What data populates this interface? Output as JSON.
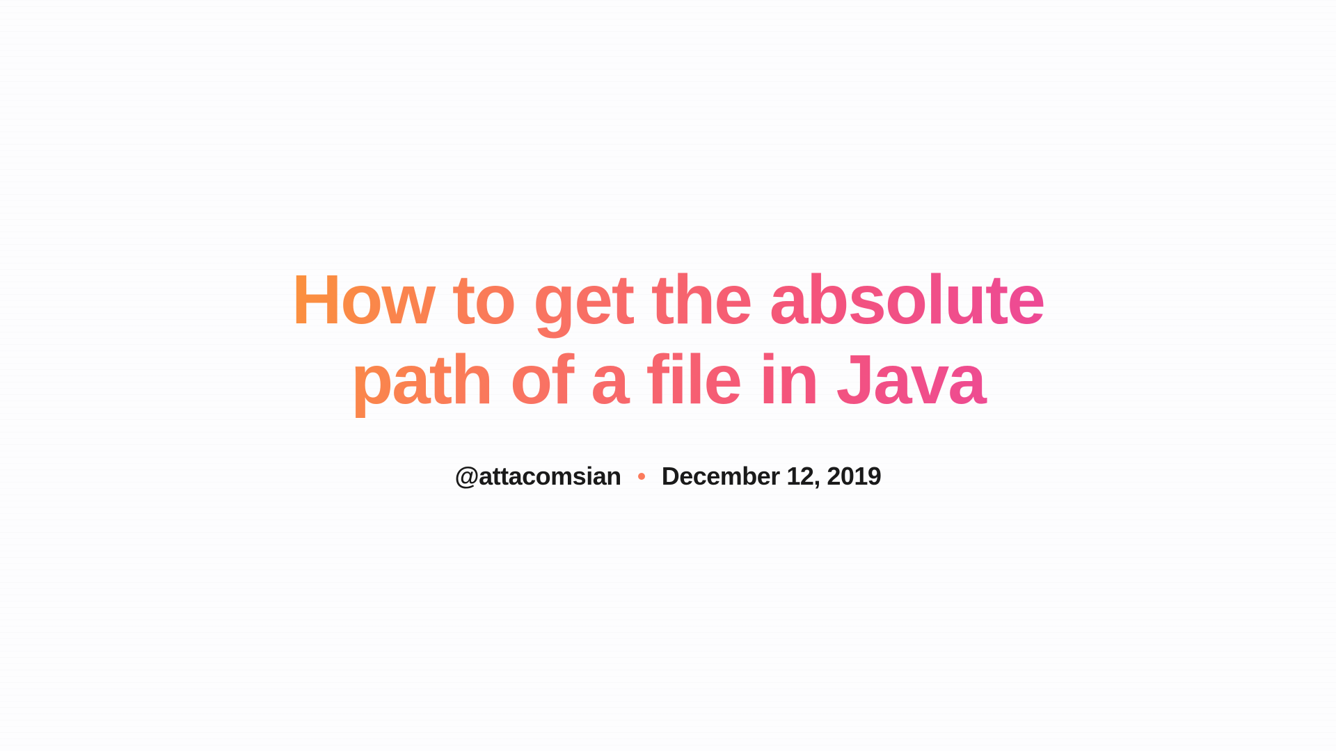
{
  "article": {
    "title": "How to get the absolute path of a file in Java",
    "author_handle": "@attacomsian",
    "date": "December 12, 2019"
  }
}
